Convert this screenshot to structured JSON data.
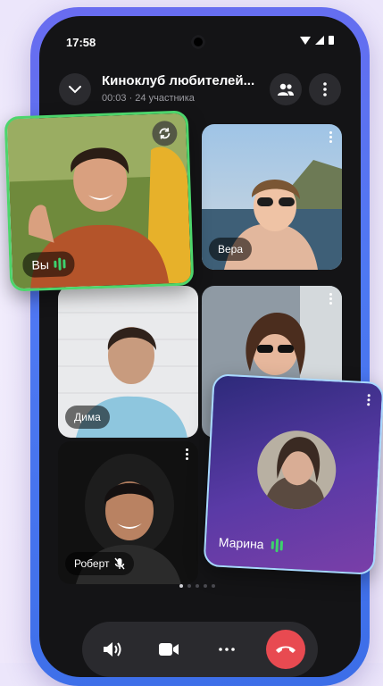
{
  "status_bar": {
    "time": "17:58"
  },
  "header": {
    "title": "Киноклуб любителей...",
    "subtitle": "00:03 · 24 участника"
  },
  "participants": [
    {
      "name": "Вы",
      "speaking": true
    },
    {
      "name": "Вера"
    },
    {
      "name": "Дима"
    },
    {
      "name": "Роберт",
      "mic": "muted"
    },
    {
      "name": "Марина",
      "speaking": true
    },
    {
      "name": ""
    }
  ],
  "pager": {
    "pages": 5,
    "current": 1
  },
  "controls": [
    "speaker-icon",
    "video-camera-icon",
    "more-icon",
    "end-call-icon"
  ],
  "colors": {
    "accent_green": "#3dd16d",
    "end_call": "#e84a51",
    "background": "#141416"
  }
}
